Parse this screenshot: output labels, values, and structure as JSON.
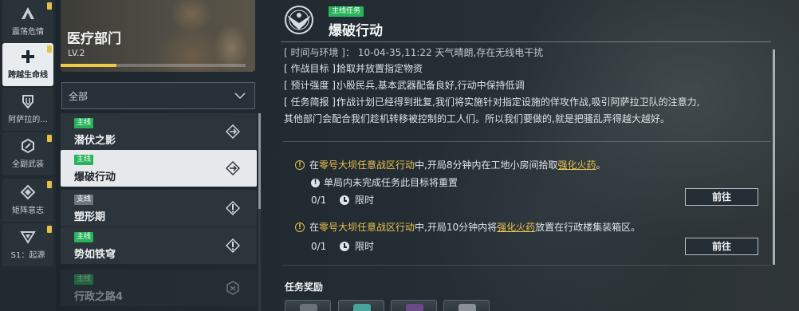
{
  "rail": {
    "items": [
      {
        "label": "震荡危情",
        "icon": "triangle-a-icon",
        "badge": true
      },
      {
        "label": "跨越生命线",
        "icon": "cross-plus-icon",
        "badge": true,
        "active": true
      },
      {
        "label": "阿萨拉的...",
        "icon": "shield-icon",
        "badge": false
      },
      {
        "label": "全副武装",
        "icon": "hex-slash-icon",
        "badge": true
      },
      {
        "label": "矩阵意志",
        "icon": "diamond-icon",
        "badge": true
      },
      {
        "label": "S1：起源",
        "icon": "chevron-triangle-icon",
        "badge": true
      }
    ]
  },
  "department": {
    "name": "医疗部门",
    "level": "LV.2",
    "progress": 0.3
  },
  "filter": {
    "selected": "全部"
  },
  "missions": [
    {
      "tag": "主线",
      "tag_type": "main",
      "name": "潜伏之影",
      "icon": "arrow-diamond-icon"
    },
    {
      "tag": "主线",
      "tag_type": "main",
      "name": "爆破行动",
      "icon": "arrow-diamond-icon",
      "selected": true
    },
    {
      "tag": "支线",
      "tag_type": "side",
      "name": "塑形期",
      "icon": "exclaim-diamond-icon"
    },
    {
      "tag": "主线",
      "tag_type": "main",
      "name": "势如铁穹",
      "icon": "exclaim-diamond-icon"
    },
    {
      "tag": "主线",
      "tag_type": "main",
      "name": "行政之路4",
      "icon": "lock-hex-icon",
      "dim": true
    }
  ],
  "detail": {
    "tag": "主线任务",
    "title": "爆破行动",
    "brief_clipped": "[ 时间与环境 ]：  10-04-35,11:22 天气晴朗,存在无线电干扰",
    "rows": [
      {
        "key": "[ 作战目标 ]：",
        "value": "拾取并放置指定物资"
      },
      {
        "key": "[ 预计强度 ]：",
        "value": "小股民兵,基本武器配备良好,行动中保持低调"
      },
      {
        "key": "[ 任务简报 ]：",
        "value": "作战计划已经得到批复,我们将实施针对指定设施的佯攻作战,吸引阿萨拉卫队的注意力,"
      }
    ],
    "brief_cont": "其他部门会配合我们趁机转移被控制的工人们。所以我们要做的,就是把骚乱弄得越大越好。"
  },
  "objectives": [
    {
      "pre": "在",
      "location": "零号大坝任意战区行动",
      "mid": "中,开局8分钟内在工地小房间拾取",
      "item": "强化火药",
      "post": "。",
      "warning": "单局内未完成任务此目标将重置",
      "progress": "0/1",
      "limit": "限时",
      "button": "前往"
    },
    {
      "pre": "在",
      "location": "零号大坝任意战区行动",
      "mid": "中,开局10分钟内将",
      "item": "强化火药",
      "post": "放置在行政楼集装箱区。",
      "progress": "0/1",
      "limit": "限时",
      "button": "前往"
    }
  ],
  "rewards": {
    "title": "任务奖励",
    "slots": [
      {
        "icon": "armor-reward-icon",
        "color": "#6b7278"
      },
      {
        "icon": "supply-reward-icon",
        "color": "#4aa39a"
      },
      {
        "icon": "purple-reward-icon",
        "color": "#6a4a86"
      },
      {
        "icon": "gray-reward-icon",
        "color": "#8a9096"
      }
    ]
  },
  "colors": {
    "accent_yellow": "#e9c24e",
    "main_tag_green": "#27b35a"
  }
}
